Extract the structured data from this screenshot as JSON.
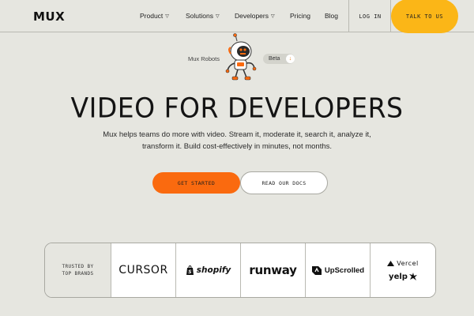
{
  "nav": {
    "logo": "MUX",
    "links": [
      {
        "label": "Product",
        "has_caret": true
      },
      {
        "label": "Solutions",
        "has_caret": true
      },
      {
        "label": "Developers",
        "has_caret": true
      },
      {
        "label": "Pricing",
        "has_caret": false
      },
      {
        "label": "Blog",
        "has_caret": false
      }
    ],
    "caret_glyph": "▽",
    "login": "LOG IN",
    "cta": "TALK TO US"
  },
  "announcement": {
    "label": "Mux Robots",
    "badge": "Beta",
    "badge_icon": "down-arrow-icon",
    "badge_arrow": "↓",
    "mascot": "robot-mascot-icon"
  },
  "hero": {
    "title": "VIDEO FOR DEVELOPERS",
    "subtitle": "Mux helps teams do more with video. Stream it, moderate it, search it, analyze it, transform it. Build cost-effectively in minutes, not months.",
    "primary_button": "GET STARTED",
    "secondary_button": "READ OUR DOCS"
  },
  "brands": {
    "trusted_line1": "TRUSTED BY",
    "trusted_line2": "TOP BRANDS",
    "cursor": "CURSOR",
    "shopify": "shopify",
    "runway": "runway",
    "upscrolled": "UpScrolled",
    "vercel": "Vercel",
    "yelp": "yelp"
  },
  "colors": {
    "background": "#e6e6e0",
    "primary_orange": "#fa6a0f",
    "cta_yellow": "#fbb617",
    "text": "#141414"
  }
}
